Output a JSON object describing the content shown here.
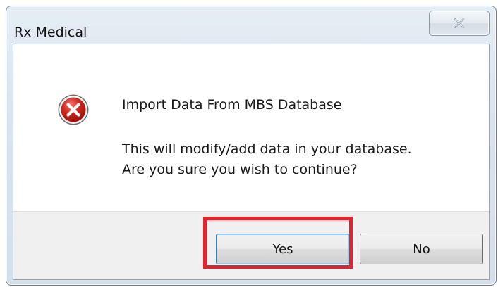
{
  "dialog": {
    "title": "Rx Medical",
    "close_icon": "close-icon",
    "icon": "error-icon",
    "heading": "Import Data From MBS Database",
    "message_line1": "This will modify/add data in your database.",
    "message_line2": "Are you sure you wish to continue?",
    "buttons": {
      "yes_label": "Yes",
      "no_label": "No"
    },
    "highlight_color": "#e8202a"
  }
}
